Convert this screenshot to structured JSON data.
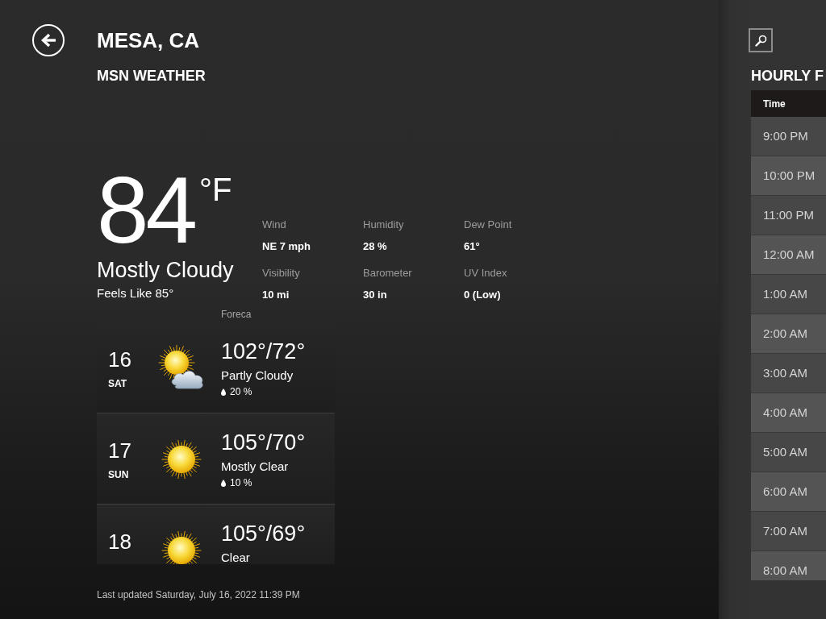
{
  "header": {
    "title": "MESA, CA",
    "subtitle": "MSN WEATHER"
  },
  "current": {
    "temperature": "84",
    "unit": "°F",
    "condition": "Mostly Cloudy",
    "feels_like": "Feels Like 85°",
    "details": [
      {
        "label": "Wind",
        "value": "NE 7 mph"
      },
      {
        "label": "Humidity",
        "value": "28 %"
      },
      {
        "label": "Dew Point",
        "value": "61°"
      },
      {
        "label": "Visibility",
        "value": "10 mi"
      },
      {
        "label": "Barometer",
        "value": "30 in"
      },
      {
        "label": "UV Index",
        "value": "0 (Low)"
      }
    ]
  },
  "forecast": {
    "source": "Foreca",
    "days": [
      {
        "date": "16",
        "weekday": "SAT",
        "kind": "partly-cloudy",
        "temps": "102°/72°",
        "condition": "Partly Cloudy",
        "precipitation": "20 %"
      },
      {
        "date": "17",
        "weekday": "SUN",
        "kind": "sunny",
        "temps": "105°/70°",
        "condition": "Mostly Clear",
        "precipitation": "10 %"
      },
      {
        "date": "18",
        "kind": "sunny",
        "temps": "105°/69°",
        "condition": "Clear"
      }
    ]
  },
  "last_updated": "Last updated Saturday, July 16, 2022 11:39 PM",
  "hourly": {
    "title": "HOURLY F",
    "columns": [
      "Time"
    ],
    "rows": [
      {
        "time": "9:00 PM"
      },
      {
        "time": "10:00 PM"
      },
      {
        "time": "11:00 PM"
      },
      {
        "time": "12:00 AM"
      },
      {
        "time": "1:00 AM"
      },
      {
        "time": "2:00 AM"
      },
      {
        "time": "3:00 AM"
      },
      {
        "time": "4:00 AM"
      },
      {
        "time": "5:00 AM"
      },
      {
        "time": "6:00 AM"
      },
      {
        "time": "7:00 AM"
      },
      {
        "time": "8:00 AM"
      }
    ]
  }
}
